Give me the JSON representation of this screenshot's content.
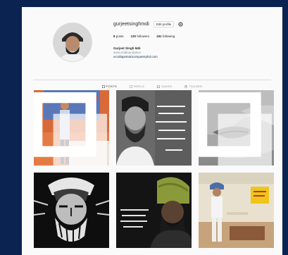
{
  "profile": {
    "username": "gurjeetsinghmdi",
    "edit_label": "Edit profile",
    "stats": [
      {
        "count": "8",
        "label": "posts"
      },
      {
        "count": "130",
        "label": "followers"
      },
      {
        "count": "191",
        "label": "following"
      }
    ],
    "name": "Gurjeet Singh Mdi",
    "bio_line": "www.mdifoundation",
    "link": "scrollapsmartcomputerphd.com"
  },
  "tabs": [
    {
      "label": "POSTS",
      "active": true
    },
    {
      "label": "REELS",
      "active": false
    },
    {
      "label": "SAVED",
      "active": false
    },
    {
      "label": "TAGGED",
      "active": false
    }
  ],
  "posts": [
    {
      "kind": "speaker-stage",
      "multi": true
    },
    {
      "kind": "quote-portrait",
      "multi": false
    },
    {
      "kind": "face-closeup",
      "multi": true
    },
    {
      "kind": "sketch-portrait",
      "multi": false
    },
    {
      "kind": "turban-text",
      "multi": false
    },
    {
      "kind": "poster-standing",
      "multi": false
    }
  ]
}
